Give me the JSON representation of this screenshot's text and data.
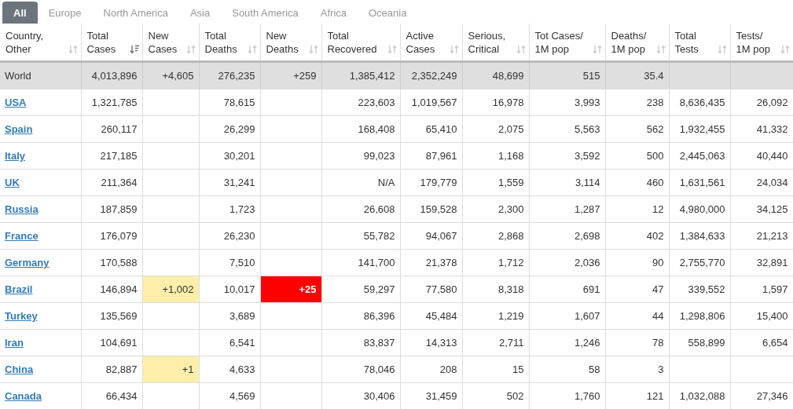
{
  "tabs": [
    {
      "label": "All",
      "selected": true
    },
    {
      "label": "Europe",
      "selected": false
    },
    {
      "label": "North America",
      "selected": false
    },
    {
      "label": "Asia",
      "selected": false
    },
    {
      "label": "South America",
      "selected": false
    },
    {
      "label": "Africa",
      "selected": false
    },
    {
      "label": "Oceania",
      "selected": false
    }
  ],
  "table": {
    "columns": [
      {
        "lines": [
          "Country,",
          "Other"
        ],
        "sorted": false
      },
      {
        "lines": [
          "Total",
          "Cases"
        ],
        "sorted": true
      },
      {
        "lines": [
          "New",
          "Cases"
        ],
        "sorted": false
      },
      {
        "lines": [
          "Total",
          "Deaths"
        ],
        "sorted": false
      },
      {
        "lines": [
          "New",
          "Deaths"
        ],
        "sorted": false
      },
      {
        "lines": [
          "Total",
          "Recovered"
        ],
        "sorted": false
      },
      {
        "lines": [
          "Active",
          "Cases"
        ],
        "sorted": false
      },
      {
        "lines": [
          "Serious,",
          "Critical"
        ],
        "sorted": false
      },
      {
        "lines": [
          "Tot Cases/",
          "1M pop"
        ],
        "sorted": false
      },
      {
        "lines": [
          "Deaths/",
          "1M pop"
        ],
        "sorted": false
      },
      {
        "lines": [
          "Total",
          "Tests"
        ],
        "sorted": false
      },
      {
        "lines": [
          "Tests/",
          "1M pop"
        ],
        "sorted": false
      }
    ],
    "rows": [
      {
        "kind": "total",
        "cells": [
          {
            "text": "World"
          },
          {
            "text": "4,013,896"
          },
          {
            "text": "+4,605"
          },
          {
            "text": "276,235"
          },
          {
            "text": "+259"
          },
          {
            "text": "1,385,412"
          },
          {
            "text": "2,352,249"
          },
          {
            "text": "48,699"
          },
          {
            "text": "515"
          },
          {
            "text": "35.4"
          },
          null,
          null
        ]
      },
      {
        "kind": "country",
        "cells": [
          {
            "text": "USA"
          },
          {
            "text": "1,321,785"
          },
          null,
          {
            "text": "78,615"
          },
          null,
          {
            "text": "223,603"
          },
          {
            "text": "1,019,567"
          },
          {
            "text": "16,978"
          },
          {
            "text": "3,993"
          },
          {
            "text": "238"
          },
          {
            "text": "8,636,435"
          },
          {
            "text": "26,092"
          }
        ]
      },
      {
        "kind": "country",
        "cells": [
          {
            "text": "Spain"
          },
          {
            "text": "260,117"
          },
          null,
          {
            "text": "26,299"
          },
          null,
          {
            "text": "168,408"
          },
          {
            "text": "65,410"
          },
          {
            "text": "2,075"
          },
          {
            "text": "5,563"
          },
          {
            "text": "562"
          },
          {
            "text": "1,932,455"
          },
          {
            "text": "41,332"
          }
        ]
      },
      {
        "kind": "country",
        "cells": [
          {
            "text": "Italy"
          },
          {
            "text": "217,185"
          },
          null,
          {
            "text": "30,201"
          },
          null,
          {
            "text": "99,023"
          },
          {
            "text": "87,961"
          },
          {
            "text": "1,168"
          },
          {
            "text": "3,592"
          },
          {
            "text": "500"
          },
          {
            "text": "2,445,063"
          },
          {
            "text": "40,440"
          }
        ]
      },
      {
        "kind": "country",
        "cells": [
          {
            "text": "UK"
          },
          {
            "text": "211,364"
          },
          null,
          {
            "text": "31,241"
          },
          null,
          {
            "text": "N/A"
          },
          {
            "text": "179,779"
          },
          {
            "text": "1,559"
          },
          {
            "text": "3,114"
          },
          {
            "text": "460"
          },
          {
            "text": "1,631,561"
          },
          {
            "text": "24,034"
          }
        ]
      },
      {
        "kind": "country",
        "cells": [
          {
            "text": "Russia"
          },
          {
            "text": "187,859"
          },
          null,
          {
            "text": "1,723"
          },
          null,
          {
            "text": "26,608"
          },
          {
            "text": "159,528"
          },
          {
            "text": "2,300"
          },
          {
            "text": "1,287"
          },
          {
            "text": "12"
          },
          {
            "text": "4,980,000"
          },
          {
            "text": "34,125"
          }
        ]
      },
      {
        "kind": "country",
        "cells": [
          {
            "text": "France"
          },
          {
            "text": "176,079"
          },
          null,
          {
            "text": "26,230"
          },
          null,
          {
            "text": "55,782"
          },
          {
            "text": "94,067"
          },
          {
            "text": "2,868"
          },
          {
            "text": "2,698"
          },
          {
            "text": "402"
          },
          {
            "text": "1,384,633"
          },
          {
            "text": "21,213"
          }
        ]
      },
      {
        "kind": "country",
        "cells": [
          {
            "text": "Germany"
          },
          {
            "text": "170,588"
          },
          null,
          {
            "text": "7,510"
          },
          null,
          {
            "text": "141,700"
          },
          {
            "text": "21,378"
          },
          {
            "text": "1,712"
          },
          {
            "text": "2,036"
          },
          {
            "text": "90"
          },
          {
            "text": "2,755,770"
          },
          {
            "text": "32,891"
          }
        ]
      },
      {
        "kind": "country",
        "cells": [
          {
            "text": "Brazil"
          },
          {
            "text": "146,894"
          },
          {
            "text": "+1,002",
            "color": "#ffeeaa"
          },
          {
            "text": "10,017"
          },
          {
            "text": "+25",
            "color": "#ff0000"
          },
          {
            "text": "59,297"
          },
          {
            "text": "77,580"
          },
          {
            "text": "8,318"
          },
          {
            "text": "691"
          },
          {
            "text": "47"
          },
          {
            "text": "339,552"
          },
          {
            "text": "1,597"
          }
        ]
      },
      {
        "kind": "country",
        "cells": [
          {
            "text": "Turkey"
          },
          {
            "text": "135,569"
          },
          null,
          {
            "text": "3,689"
          },
          null,
          {
            "text": "86,396"
          },
          {
            "text": "45,484"
          },
          {
            "text": "1,219"
          },
          {
            "text": "1,607"
          },
          {
            "text": "44"
          },
          {
            "text": "1,298,806"
          },
          {
            "text": "15,400"
          }
        ]
      },
      {
        "kind": "country",
        "cells": [
          {
            "text": "Iran"
          },
          {
            "text": "104,691"
          },
          null,
          {
            "text": "6,541"
          },
          null,
          {
            "text": "83,837"
          },
          {
            "text": "14,313"
          },
          {
            "text": "2,711"
          },
          {
            "text": "1,246"
          },
          {
            "text": "78"
          },
          {
            "text": "558,899"
          },
          {
            "text": "6,654"
          }
        ]
      },
      {
        "kind": "country",
        "cells": [
          {
            "text": "China"
          },
          {
            "text": "82,887"
          },
          {
            "text": "+1",
            "color": "#ffeeaa"
          },
          {
            "text": "4,633"
          },
          null,
          {
            "text": "78,046"
          },
          {
            "text": "208"
          },
          {
            "text": "15"
          },
          {
            "text": "58"
          },
          {
            "text": "3"
          },
          null,
          null
        ]
      },
      {
        "kind": "country",
        "cells": [
          {
            "text": "Canada"
          },
          {
            "text": "66,434"
          },
          null,
          {
            "text": "4,569"
          },
          null,
          {
            "text": "30,406"
          },
          {
            "text": "31,459"
          },
          {
            "text": "502"
          },
          {
            "text": "1,760"
          },
          {
            "text": "121"
          },
          {
            "text": "1,032,088"
          },
          {
            "text": "27,346"
          }
        ]
      }
    ]
  }
}
